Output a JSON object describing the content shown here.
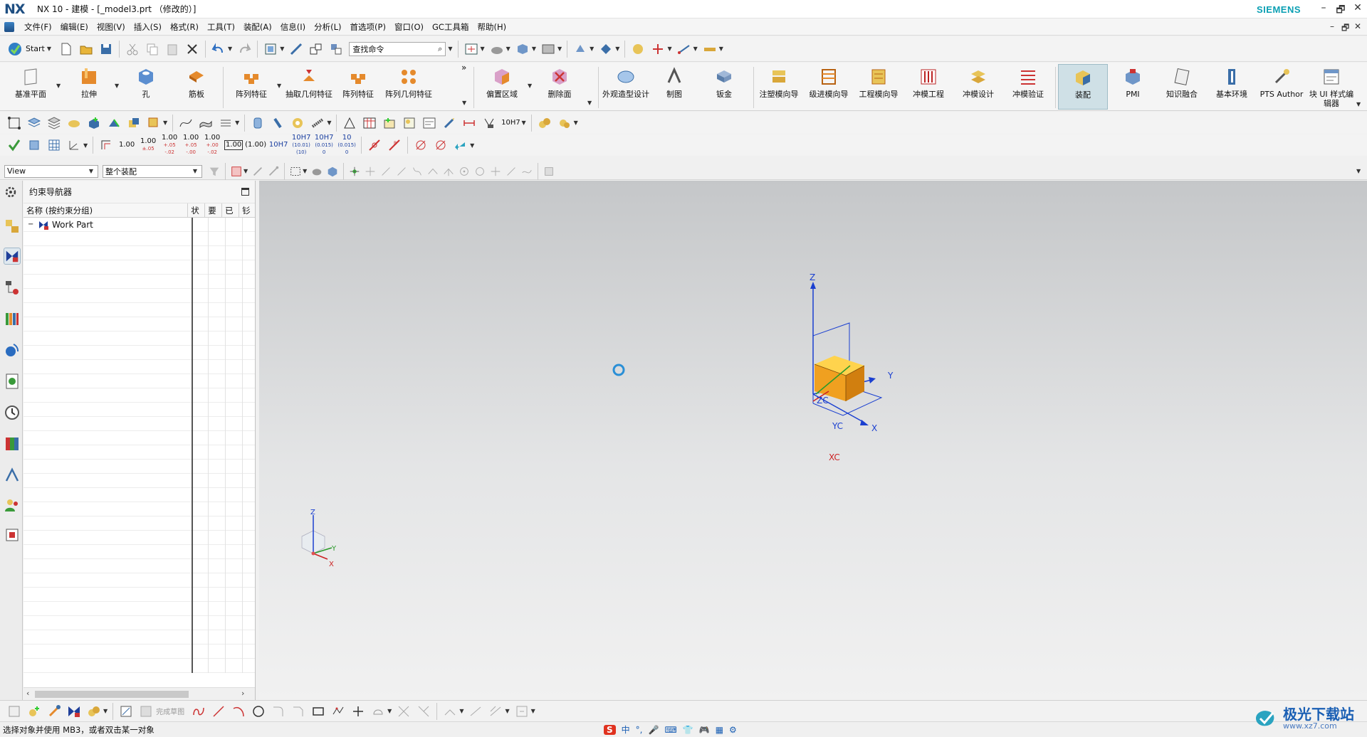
{
  "app": {
    "logo": "NX",
    "title": "NX 10 - 建模 - [_model3.prt （修改的）]",
    "brand": "SIEMENS",
    "window_controls": [
      "–",
      "🗗",
      "✕"
    ]
  },
  "menubar": {
    "items": [
      "文件(F)",
      "编辑(E)",
      "视图(V)",
      "插入(S)",
      "格式(R)",
      "工具(T)",
      "装配(A)",
      "信息(I)",
      "分析(L)",
      "首选项(P)",
      "窗口(O)",
      "GC工具箱",
      "帮助(H)"
    ]
  },
  "toolbar1": {
    "start_label": "Start",
    "find_placeholder": "查找命令"
  },
  "ribbon": {
    "buttons": [
      {
        "label": "基准平面",
        "icon": "datum-plane-icon"
      },
      {
        "label": "拉伸",
        "icon": "extrude-icon"
      },
      {
        "label": "孔",
        "icon": "hole-icon"
      },
      {
        "label": "筋板",
        "icon": "rib-icon"
      },
      {
        "label": "阵列特征",
        "icon": "pattern-feature-icon"
      },
      {
        "label": "抽取几何特征",
        "icon": "extract-geometry-icon"
      },
      {
        "label": "阵列特征",
        "icon": "pattern-feature-icon"
      },
      {
        "label": "阵列几何特征",
        "icon": "pattern-geometry-icon"
      },
      {
        "label": "偏置区域",
        "icon": "offset-region-icon"
      },
      {
        "label": "删除面",
        "icon": "delete-face-icon"
      },
      {
        "label": "外观造型设计",
        "icon": "shape-studio-icon"
      },
      {
        "label": "制图",
        "icon": "drafting-icon"
      },
      {
        "label": "钣金",
        "icon": "sheet-metal-icon"
      },
      {
        "label": "注塑模向导",
        "icon": "mold-wizard-icon"
      },
      {
        "label": "级进模向导",
        "icon": "progressive-die-icon"
      },
      {
        "label": "工程模向导",
        "icon": "engineering-die-icon"
      },
      {
        "label": "冲模工程",
        "icon": "die-engineering-icon"
      },
      {
        "label": "冲模设计",
        "icon": "die-design-icon"
      },
      {
        "label": "冲模验证",
        "icon": "die-validation-icon"
      },
      {
        "label": "装配",
        "icon": "assembly-icon"
      },
      {
        "label": "PMI",
        "icon": "pmi-icon"
      },
      {
        "label": "知识融合",
        "icon": "knowledge-fusion-icon"
      },
      {
        "label": "基本环境",
        "icon": "gateway-icon"
      },
      {
        "label": "PTS Author",
        "icon": "pts-author-icon"
      },
      {
        "label": "块 UI 样式编辑器",
        "icon": "block-ui-styler-icon"
      }
    ]
  },
  "pmi_toolbar": {
    "values": [
      "1.00",
      "1.00",
      "1.00",
      "1.00",
      "1.00",
      "1.00",
      "(1.00)",
      "10H7",
      "10H7",
      "10H7",
      "10"
    ],
    "subvalues": [
      "",
      "±.05",
      "+.05\n-.02",
      "+.05\n-.00",
      "+.00\n-.02",
      "",
      "",
      "",
      "(10.01)\n(10)",
      "(0.015)\n0",
      "(0.015)\n0"
    ],
    "h7_dropdown": "10H7"
  },
  "filterbar": {
    "view_filter": "View",
    "assembly_filter": "整个装配"
  },
  "navigator": {
    "title": "约束导航器",
    "columns": [
      "名称 (按约束分组)",
      "状",
      "要",
      "已",
      "钐"
    ],
    "root_item": "Work Part",
    "expand_symbol": "−"
  },
  "graphics": {
    "axis_labels": {
      "z": "Z",
      "y": "Y",
      "x": "X",
      "zc": "ZC",
      "yc": "YC",
      "xc": "XC"
    },
    "triad_labels": {
      "z": "Z",
      "y": "Y",
      "x": "X"
    },
    "accent_orange": "#f0a020",
    "csys_blue": "#1a3fd0"
  },
  "bottom_toolbar": {
    "finish_sketch_label": "完成草图"
  },
  "statusbar": {
    "prompt": "选择对象并使用 MB3，或者双击某一对象"
  },
  "ime": {
    "items": [
      "S",
      "中",
      "°,",
      "🎤",
      "⌨",
      "👕",
      "🎮",
      "▦",
      "⚙"
    ]
  },
  "watermark": {
    "name": "极光下载站",
    "url": "www.xz7.com"
  }
}
